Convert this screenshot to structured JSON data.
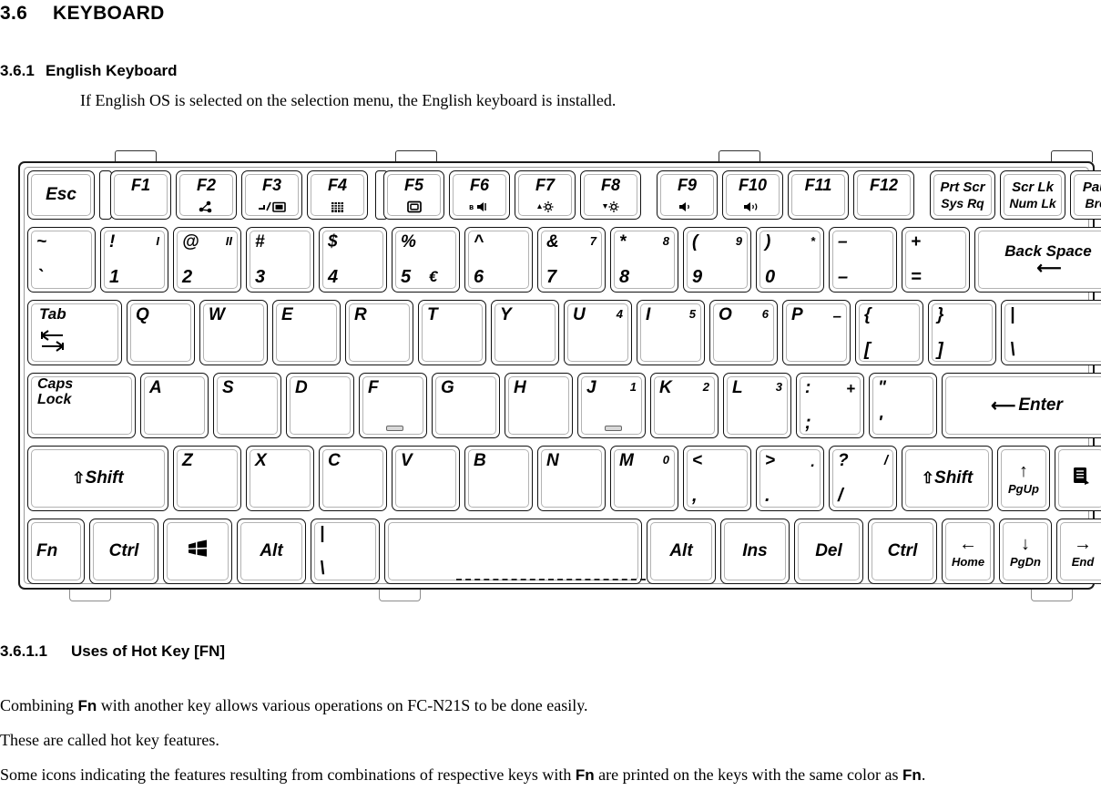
{
  "section": {
    "number": "3.6",
    "title": "KEYBOARD"
  },
  "subsection": {
    "number": "3.6.1",
    "title": "English Keyboard",
    "intro": "If English OS is selected on the selection menu, the English keyboard is installed."
  },
  "hotkey": {
    "number": "3.6.1.1",
    "title": "Uses of Hot Key [FN]",
    "p1_before": "Combining ",
    "p1_fn": "Fn",
    "p1_after": " with another key allows various operations on FC-N21S to be done easily.",
    "p2": "These are called hot key features.",
    "p3_before": "Some icons indicating the features resulting from combinations of respective keys with ",
    "p3_fn": "Fn",
    "p3_mid": " are printed on the keys with the same color as ",
    "p3_fn2": "Fn",
    "p3_end": "."
  },
  "keyboard": {
    "function_row": [
      {
        "label": "Esc",
        "icon": ""
      },
      {
        "label": "F1",
        "icon": ""
      },
      {
        "label": "F2",
        "icon": "network-icon"
      },
      {
        "label": "F3",
        "icon": "display-switch-icon"
      },
      {
        "label": "F4",
        "icon": "panel-icon"
      },
      {
        "label": "F5",
        "icon": "monitor-icon"
      },
      {
        "label": "F6",
        "icon": "mute-speaker-icon"
      },
      {
        "label": "F7",
        "icon": "brightness-up-icon"
      },
      {
        "label": "F8",
        "icon": "brightness-down-icon"
      },
      {
        "label": "F9",
        "icon": "volume-down-icon"
      },
      {
        "label": "F10",
        "icon": "volume-up-icon"
      },
      {
        "label": "F11",
        "icon": ""
      },
      {
        "label": "F12",
        "icon": ""
      }
    ],
    "function_row_special": [
      {
        "top": "Prt Scr",
        "bottom": "Sys Rq"
      },
      {
        "top": "Scr Lk",
        "bottom": "Num Lk"
      },
      {
        "top": "Pause",
        "bottom": "Break"
      }
    ],
    "number_row": [
      {
        "upper": "~",
        "lower": "`",
        "numpad": ""
      },
      {
        "upper": "!",
        "lower": "1",
        "numpad": "I"
      },
      {
        "upper": "@",
        "lower": "2",
        "numpad": "II"
      },
      {
        "upper": "#",
        "lower": "3",
        "numpad": ""
      },
      {
        "upper": "$",
        "lower": "4",
        "numpad": ""
      },
      {
        "upper": "%",
        "lower": "5",
        "numpad": "",
        "extra": "€"
      },
      {
        "upper": "^",
        "lower": "6",
        "numpad": ""
      },
      {
        "upper": "&",
        "lower": "7",
        "numpad": "7"
      },
      {
        "upper": "*",
        "lower": "8",
        "numpad": "8"
      },
      {
        "upper": "(",
        "lower": "9",
        "numpad": "9"
      },
      {
        "upper": ")",
        "lower": "0",
        "numpad": "*"
      },
      {
        "upper": "–",
        "lower": "–",
        "numpad": ""
      },
      {
        "upper": "+",
        "lower": "=",
        "numpad": ""
      }
    ],
    "backspace": {
      "label": "Back Space",
      "arrow": "←"
    },
    "tab_key": {
      "label": "Tab",
      "arrow_left": "⇤",
      "arrow_right": "⇥"
    },
    "qwerty_row": [
      {
        "main": "Q",
        "numpad": ""
      },
      {
        "main": "W",
        "numpad": ""
      },
      {
        "main": "E",
        "numpad": ""
      },
      {
        "main": "R",
        "numpad": ""
      },
      {
        "main": "T",
        "numpad": ""
      },
      {
        "main": "Y",
        "numpad": ""
      },
      {
        "main": "U",
        "numpad": "4"
      },
      {
        "main": "I",
        "numpad": "5"
      },
      {
        "main": "O",
        "numpad": "6"
      },
      {
        "main": "P",
        "numpad": "–"
      }
    ],
    "qwerty_sym": [
      {
        "upper": "{",
        "lower": "["
      },
      {
        "upper": "}",
        "lower": "]"
      },
      {
        "upper": "|",
        "lower": "\\"
      }
    ],
    "caps_key": {
      "top": "Caps",
      "bottom": "Lock"
    },
    "home_row": [
      {
        "main": "A",
        "numpad": ""
      },
      {
        "main": "S",
        "numpad": ""
      },
      {
        "main": "D",
        "numpad": ""
      },
      {
        "main": "F",
        "numpad": "",
        "homing": true
      },
      {
        "main": "G",
        "numpad": ""
      },
      {
        "main": "H",
        "numpad": ""
      },
      {
        "main": "J",
        "numpad": "1",
        "homing": true
      },
      {
        "main": "K",
        "numpad": "2"
      },
      {
        "main": "L",
        "numpad": "3"
      }
    ],
    "home_sym": [
      {
        "upper": ":",
        "lower": ";",
        "numpad": "+"
      },
      {
        "upper": "\"",
        "lower": "'",
        "numpad": ""
      }
    ],
    "enter_key": {
      "label": "Enter",
      "arrow": "←"
    },
    "shift_left": {
      "glyph": "⇧",
      "label": "Shift"
    },
    "shift_right": {
      "glyph": "⇧",
      "label": "Shift"
    },
    "zxcv_row": [
      {
        "main": "Z",
        "numpad": ""
      },
      {
        "main": "X",
        "numpad": ""
      },
      {
        "main": "C",
        "numpad": ""
      },
      {
        "main": "V",
        "numpad": ""
      },
      {
        "main": "B",
        "numpad": ""
      },
      {
        "main": "N",
        "numpad": ""
      },
      {
        "main": "M",
        "numpad": "0"
      }
    ],
    "zxcv_sym": [
      {
        "upper": "<",
        "lower": ",",
        "numpad": ""
      },
      {
        "upper": ">",
        "lower": ".",
        "numpad": "."
      },
      {
        "upper": "?",
        "lower": "/",
        "numpad": "/"
      }
    ],
    "menu_key": {
      "icon": "context-menu-icon"
    },
    "bottom_row": [
      {
        "label": "Fn"
      },
      {
        "label": "Ctrl"
      },
      {
        "label": "",
        "icon": "windows-logo-icon"
      },
      {
        "label": "Alt"
      }
    ],
    "bottom_backslash": {
      "upper": "|",
      "lower": "\\"
    },
    "spacebar": {
      "label": ""
    },
    "bottom_right": [
      {
        "label": "Alt"
      },
      {
        "label": "Ins"
      },
      {
        "label": "Del"
      },
      {
        "label": "Ctrl"
      }
    ],
    "arrow_keys": {
      "up": {
        "glyph": "↑",
        "sub": "PgUp"
      },
      "left": {
        "glyph": "←",
        "sub": "Home"
      },
      "down": {
        "glyph": "↓",
        "sub": "PgDn"
      },
      "right": {
        "glyph": "→",
        "sub": "End"
      }
    }
  }
}
